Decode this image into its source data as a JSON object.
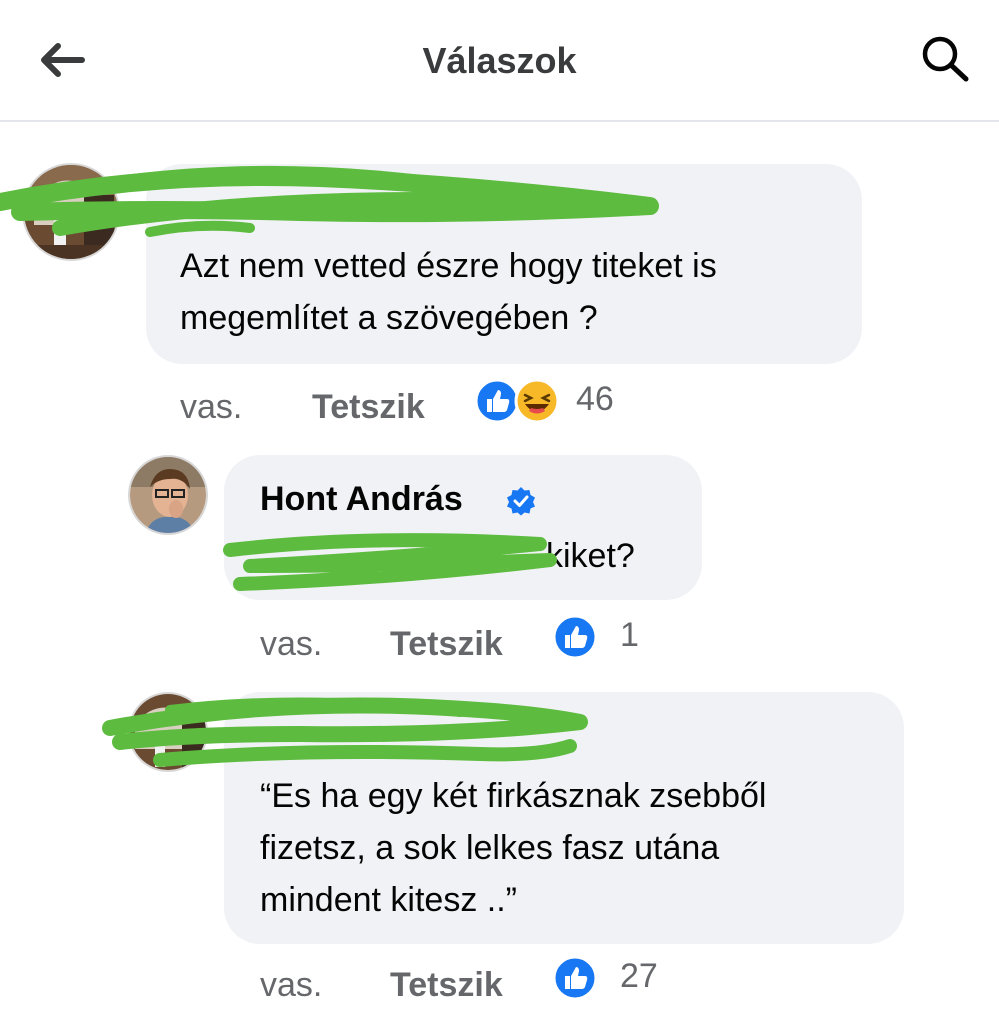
{
  "header": {
    "title": "Válaszok",
    "back_icon": "arrow-left-icon",
    "search_icon": "search-icon"
  },
  "colors": {
    "like_blue": "#1877f2",
    "bubble_bg": "#f0f2f5",
    "meta_gray": "#65676b",
    "redaction_green": "#5dbb3f"
  },
  "comments": [
    {
      "author": "",
      "text_lines": [
        "Azt nem vetted  észre hogy titeket is",
        "megemlítet a szövegében ?"
      ],
      "time": "vas.",
      "like_label": "Tetszik",
      "reactions": [
        "like",
        "haha"
      ],
      "reaction_count": "46"
    },
    {
      "author": "Hont András",
      "verified": true,
      "text_lines": [
        "kiket?"
      ],
      "time": "vas.",
      "like_label": "Tetszik",
      "reactions": [
        "like"
      ],
      "reaction_count": "1"
    },
    {
      "author": "",
      "text_lines": [
        "“Es ha egy két firkásznak zsebből",
        "fizetsz, a sok lelkes fasz utána",
        "mindent kitesz ..”"
      ],
      "time": "vas.",
      "like_label": "Tetszik",
      "reactions": [
        "like"
      ],
      "reaction_count": "27"
    }
  ]
}
